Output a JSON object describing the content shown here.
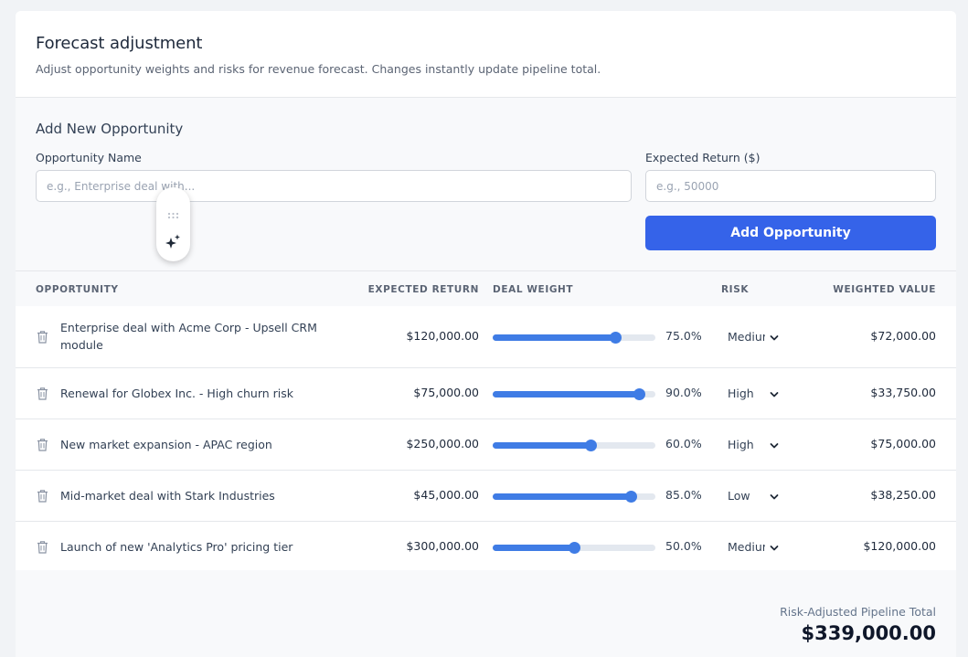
{
  "header": {
    "title": "Forecast adjustment",
    "subtitle": "Adjust opportunity weights and risks for revenue forecast. Changes instantly update pipeline total."
  },
  "form": {
    "section_title": "Add New Opportunity",
    "name_label": "Opportunity Name",
    "name_placeholder": "e.g., Enterprise deal with...",
    "name_value": "",
    "return_label": "Expected Return ($)",
    "return_placeholder": "e.g., 50000",
    "return_value": "",
    "add_button": "Add Opportunity"
  },
  "floating_toolbar": {
    "icons": [
      "drag-handle-icon",
      "sparkle-icon"
    ]
  },
  "table": {
    "columns": {
      "opportunity": "OPPORTUNITY",
      "expected_return": "EXPECTED RETURN",
      "deal_weight": "DEAL WEIGHT",
      "risk": "RISK",
      "weighted_value": "WEIGHTED VALUE"
    },
    "rows": [
      {
        "name": "Enterprise deal with Acme Corp - Upsell CRM module",
        "expected": "$120,000.00",
        "weight": 0.75,
        "weight_label": "75.0%",
        "risk": "Medium",
        "weighted": "$72,000.00"
      },
      {
        "name": "Renewal for Globex Inc. - High churn risk",
        "expected": "$75,000.00",
        "weight": 0.9,
        "weight_label": "90.0%",
        "risk": "High",
        "weighted": "$33,750.00"
      },
      {
        "name": "New market expansion - APAC region",
        "expected": "$250,000.00",
        "weight": 0.6,
        "weight_label": "60.0%",
        "risk": "High",
        "weighted": "$75,000.00"
      },
      {
        "name": "Mid-market deal with Stark Industries",
        "expected": "$45,000.00",
        "weight": 0.85,
        "weight_label": "85.0%",
        "risk": "Low",
        "weighted": "$38,250.00"
      },
      {
        "name": "Launch of new 'Analytics Pro' pricing tier",
        "expected": "$300,000.00",
        "weight": 0.5,
        "weight_label": "50.0%",
        "risk": "Medium",
        "weighted": "$120,000.00"
      }
    ]
  },
  "footer": {
    "total_label": "Risk-Adjusted Pipeline Total",
    "total_value": "$339,000.00"
  },
  "colors": {
    "accent": "#3563e9",
    "slider": "#3f7ce5",
    "track": "#e3e8ef"
  }
}
